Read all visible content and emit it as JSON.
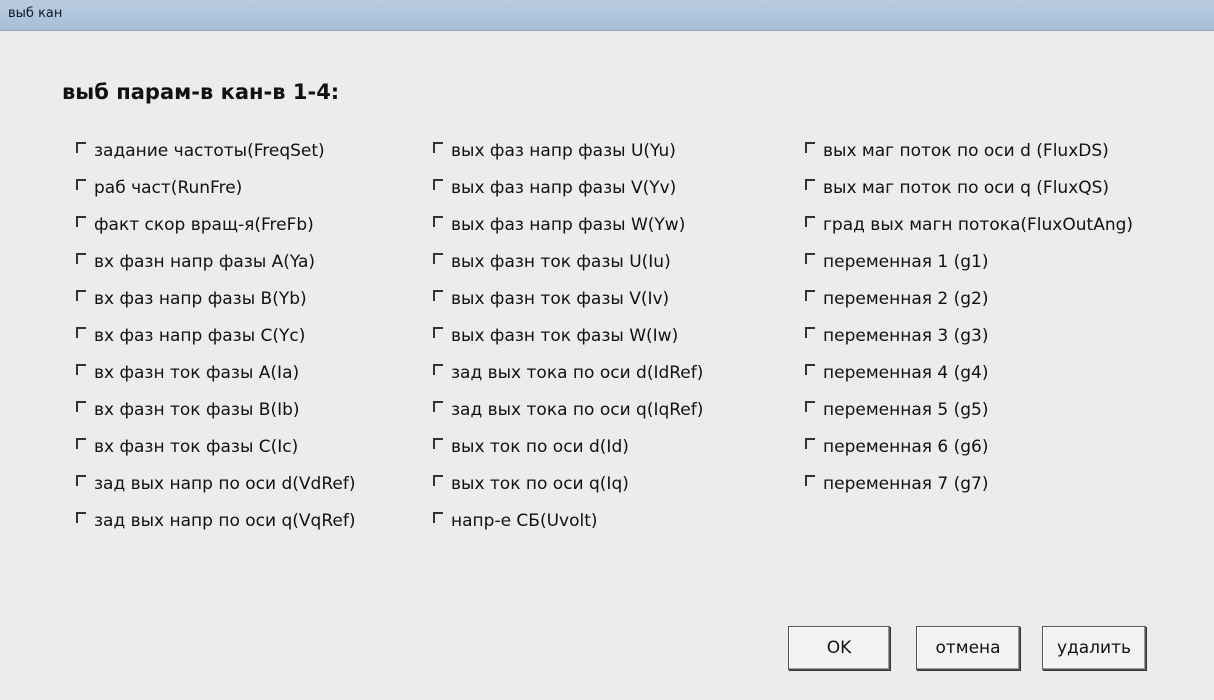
{
  "window": {
    "title": "выб кан"
  },
  "heading": "выб парам-в кан-в 1-4:",
  "columns": [
    [
      {
        "label": "задание частоты(FreqSet)",
        "checked": false
      },
      {
        "label": "раб част(RunFre)",
        "checked": false
      },
      {
        "label": "факт скор вращ-я(FreFb)",
        "checked": false
      },
      {
        "label": "вх фазн напр фазы A(Ya)",
        "checked": false
      },
      {
        "label": "вх фаз напр фазы B(Yb)",
        "checked": false
      },
      {
        "label": "вх фаз напр фазы C(Yc)",
        "checked": false
      },
      {
        "label": "вх фазн ток фазы A(Ia)",
        "checked": false
      },
      {
        "label": "вх фазн ток фазы B(Ib)",
        "checked": false
      },
      {
        "label": "вх фазн ток фазы C(Ic)",
        "checked": false
      },
      {
        "label": "зад вых напр по оси d(VdRef)",
        "checked": false
      },
      {
        "label": "зад вых напр по оси q(VqRef)",
        "checked": false
      }
    ],
    [
      {
        "label": "вых фаз напр фазы U(Yu)",
        "checked": false
      },
      {
        "label": "вых фаз напр фазы V(Yv)",
        "checked": false
      },
      {
        "label": "вых фаз напр фазы W(Yw)",
        "checked": false
      },
      {
        "label": "вых фазн ток фазы U(Iu)",
        "checked": false
      },
      {
        "label": "вых фазн ток фазы V(Iv)",
        "checked": false
      },
      {
        "label": "вых фазн ток фазы W(Iw)",
        "checked": false
      },
      {
        "label": "зад вых тока по оси d(IdRef)",
        "checked": false
      },
      {
        "label": "зад вых тока по оси q(IqRef)",
        "checked": false
      },
      {
        "label": "вых ток по оси d(Id)",
        "checked": false
      },
      {
        "label": "вых ток по оси q(Iq)",
        "checked": false
      },
      {
        "label": "напр-е СБ(Uvolt)",
        "checked": false
      }
    ],
    [
      {
        "label": "вых маг поток по оси d (FluxDS)",
        "checked": false
      },
      {
        "label": "вых маг поток по оси q (FluxQS)",
        "checked": false
      },
      {
        "label": "град вых магн потока(FluxOutAng)",
        "checked": false
      },
      {
        "label": "переменная 1 (g1)",
        "checked": false
      },
      {
        "label": "переменная 2 (g2)",
        "checked": false
      },
      {
        "label": "переменная 3 (g3)",
        "checked": false
      },
      {
        "label": "переменная 4 (g4)",
        "checked": false
      },
      {
        "label": "переменная 5 (g5)",
        "checked": false
      },
      {
        "label": "переменная 6 (g6)",
        "checked": false
      },
      {
        "label": "переменная 7 (g7)",
        "checked": false
      }
    ]
  ],
  "buttons": {
    "ok": "OK",
    "cancel": "отмена",
    "delete": "удалить"
  }
}
